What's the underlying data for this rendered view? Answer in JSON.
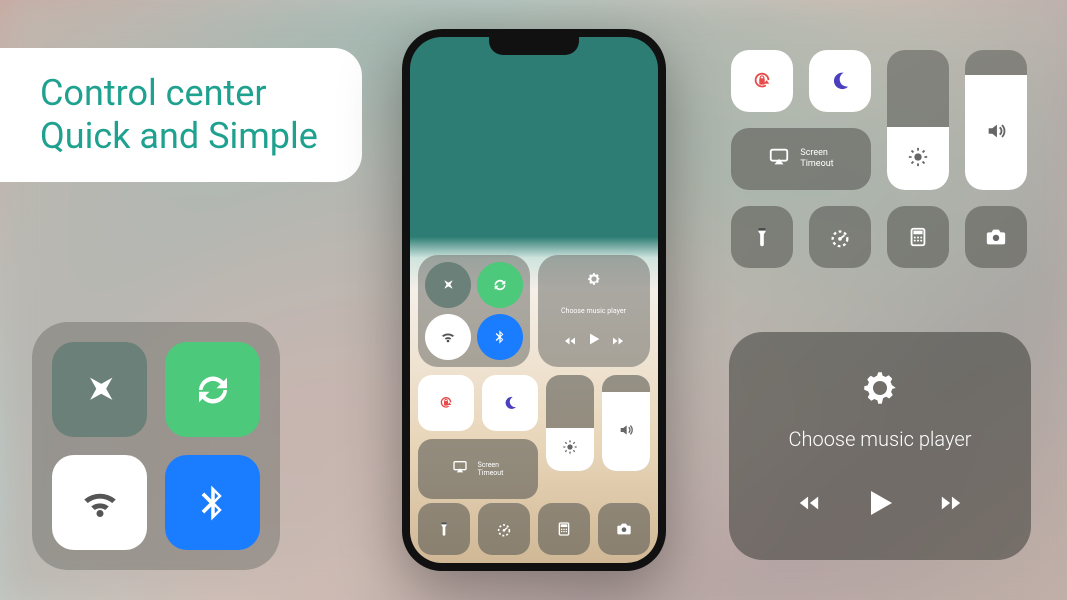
{
  "headline": {
    "line1": "Control center",
    "line2": "Quick and Simple"
  },
  "music": {
    "settings_label": "Choose music player"
  },
  "screen_mirror": {
    "label_line1": "Screen",
    "label_line2": "Timeout"
  },
  "sliders": {
    "brightness_pct": 45,
    "volume_pct": 82
  },
  "colors": {
    "accent_green": "#4cc97a",
    "accent_blue": "#1a7dff",
    "accent_red": "#e84a4a",
    "accent_purple": "#4a3fbf",
    "headline_teal": "#1fa18f"
  },
  "icons": {
    "airplane": "airplane",
    "sync": "sync",
    "wifi": "wifi",
    "bluetooth": "bluetooth",
    "rotation_lock": "rotation-lock",
    "dnd": "moon",
    "screen_mirror": "airplay",
    "brightness": "sun",
    "volume": "speaker",
    "flashlight": "flashlight",
    "speedometer": "gauge",
    "calculator": "calculator",
    "camera": "camera",
    "settings": "gear",
    "play": "play",
    "prev": "rewind",
    "next": "forward"
  }
}
